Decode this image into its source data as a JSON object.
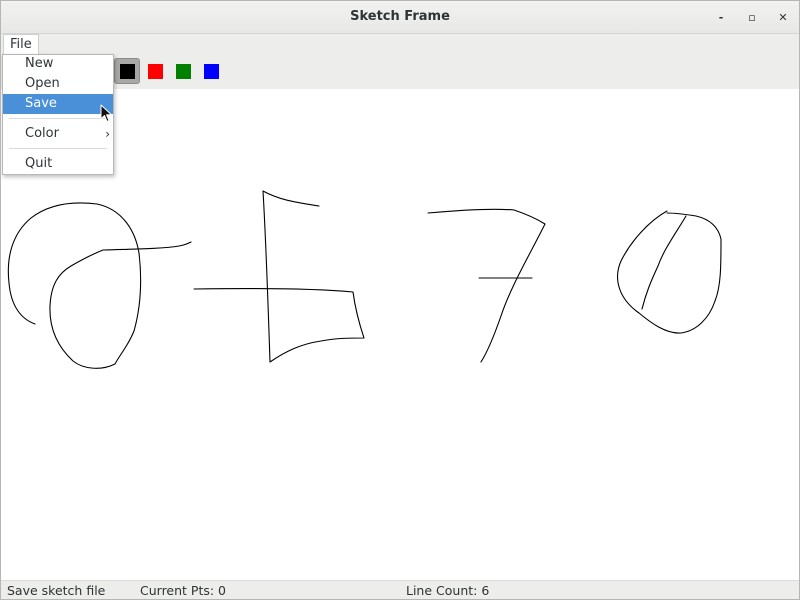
{
  "window": {
    "title": "Sketch Frame",
    "controls": {
      "minimize": "-",
      "maximize": "▫",
      "close": "✕"
    }
  },
  "menubar": {
    "file_label": "File"
  },
  "file_menu": {
    "items": [
      {
        "label": "New"
      },
      {
        "label": "Open"
      },
      {
        "label": "Save"
      },
      {
        "label": "Color",
        "submenu_arrow": "›"
      },
      {
        "label": "Quit"
      }
    ],
    "highlighted": "Save"
  },
  "toolbar": {
    "colors": [
      {
        "name": "black",
        "hex": "#000000",
        "selected": true
      },
      {
        "name": "red",
        "hex": "#ff0000",
        "selected": false
      },
      {
        "name": "green",
        "hex": "#008000",
        "selected": false
      },
      {
        "name": "blue",
        "hex": "#0000ff",
        "selected": false
      }
    ]
  },
  "status": {
    "message": "Save sketch file",
    "current_pts": "Current Pts: 0",
    "line_count": "Line Count: 6"
  },
  "colors": {
    "menu_highlight": "#4a90d9",
    "stroke": "#000000"
  }
}
